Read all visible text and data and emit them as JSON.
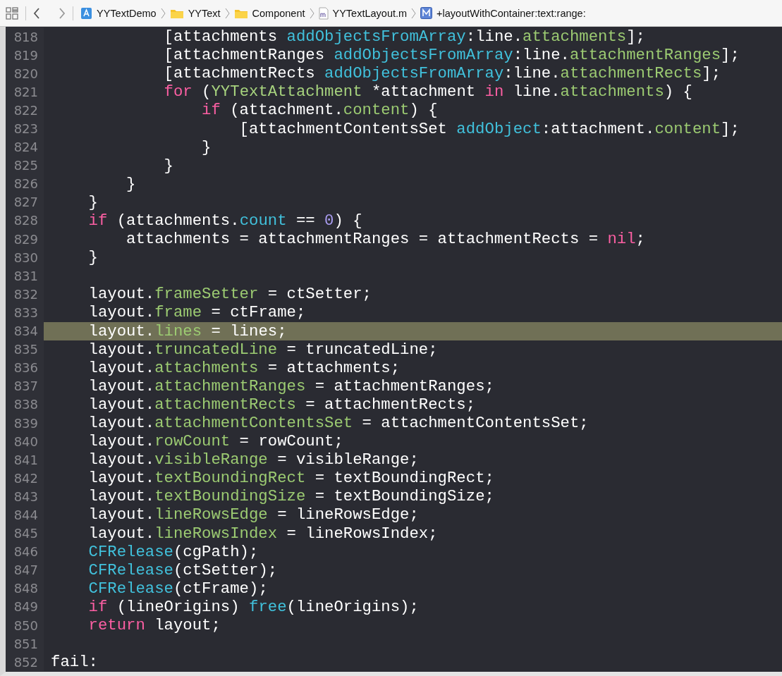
{
  "jump_bar": {
    "crumbs": [
      {
        "kind": "app",
        "label": "YYTextDemo"
      },
      {
        "kind": "folder",
        "label": "YYText"
      },
      {
        "kind": "folder",
        "label": "Component"
      },
      {
        "kind": "file",
        "label": "YYTextLayout.m"
      },
      {
        "kind": "method",
        "label": "+layoutWithContainer:text:range:"
      }
    ]
  },
  "editor": {
    "lines": [
      {
        "number": "818",
        "current": false,
        "tokens": [
          {
            "kind": "plain",
            "text": "            [attachments "
          },
          {
            "kind": "call",
            "text": "addObjectsFromArray"
          },
          {
            "kind": "plain",
            "text": ":line."
          },
          {
            "kind": "prop",
            "text": "attachments"
          },
          {
            "kind": "plain",
            "text": "];"
          }
        ]
      },
      {
        "number": "819",
        "current": false,
        "tokens": [
          {
            "kind": "plain",
            "text": "            [attachmentRanges "
          },
          {
            "kind": "call",
            "text": "addObjectsFromArray"
          },
          {
            "kind": "plain",
            "text": ":line."
          },
          {
            "kind": "prop",
            "text": "attachmentRanges"
          },
          {
            "kind": "plain",
            "text": "];"
          }
        ]
      },
      {
        "number": "820",
        "current": false,
        "tokens": [
          {
            "kind": "plain",
            "text": "            [attachmentRects "
          },
          {
            "kind": "call",
            "text": "addObjectsFromArray"
          },
          {
            "kind": "plain",
            "text": ":line."
          },
          {
            "kind": "prop",
            "text": "attachmentRects"
          },
          {
            "kind": "plain",
            "text": "];"
          }
        ]
      },
      {
        "number": "821",
        "current": false,
        "tokens": [
          {
            "kind": "keyword",
            "text": "            for"
          },
          {
            "kind": "plain",
            "text": " ("
          },
          {
            "kind": "type",
            "text": "YYTextAttachment"
          },
          {
            "kind": "plain",
            "text": " *attachment "
          },
          {
            "kind": "keyword",
            "text": "in"
          },
          {
            "kind": "plain",
            "text": " line."
          },
          {
            "kind": "prop",
            "text": "attachments"
          },
          {
            "kind": "plain",
            "text": ") {"
          }
        ]
      },
      {
        "number": "822",
        "current": false,
        "tokens": [
          {
            "kind": "keyword",
            "text": "                if"
          },
          {
            "kind": "plain",
            "text": " (attachment."
          },
          {
            "kind": "prop",
            "text": "content"
          },
          {
            "kind": "plain",
            "text": ") {"
          }
        ]
      },
      {
        "number": "823",
        "current": false,
        "tokens": [
          {
            "kind": "plain",
            "text": "                    [attachmentContentsSet "
          },
          {
            "kind": "call",
            "text": "addObject"
          },
          {
            "kind": "plain",
            "text": ":attachment."
          },
          {
            "kind": "prop",
            "text": "content"
          },
          {
            "kind": "plain",
            "text": "];"
          }
        ]
      },
      {
        "number": "824",
        "current": false,
        "tokens": [
          {
            "kind": "plain",
            "text": "                }"
          }
        ]
      },
      {
        "number": "825",
        "current": false,
        "tokens": [
          {
            "kind": "plain",
            "text": "            }"
          }
        ]
      },
      {
        "number": "826",
        "current": false,
        "tokens": [
          {
            "kind": "plain",
            "text": "        }"
          }
        ]
      },
      {
        "number": "827",
        "current": false,
        "tokens": [
          {
            "kind": "plain",
            "text": "    }"
          }
        ]
      },
      {
        "number": "828",
        "current": false,
        "tokens": [
          {
            "kind": "keyword",
            "text": "    if"
          },
          {
            "kind": "plain",
            "text": " (attachments."
          },
          {
            "kind": "call",
            "text": "count"
          },
          {
            "kind": "plain",
            "text": " == "
          },
          {
            "kind": "number",
            "text": "0"
          },
          {
            "kind": "plain",
            "text": ") {"
          }
        ]
      },
      {
        "number": "829",
        "current": false,
        "tokens": [
          {
            "kind": "plain",
            "text": "        attachments = attachmentRanges = attachmentRects = "
          },
          {
            "kind": "keyword",
            "text": "nil"
          },
          {
            "kind": "plain",
            "text": ";"
          }
        ]
      },
      {
        "number": "830",
        "current": false,
        "tokens": [
          {
            "kind": "plain",
            "text": "    }"
          }
        ]
      },
      {
        "number": "831",
        "current": false
      },
      {
        "number": "832",
        "current": false,
        "tokens": [
          {
            "kind": "plain",
            "text": "    layout."
          },
          {
            "kind": "prop",
            "text": "frameSetter"
          },
          {
            "kind": "plain",
            "text": " = ctSetter;"
          }
        ]
      },
      {
        "number": "833",
        "current": false,
        "tokens": [
          {
            "kind": "plain",
            "text": "    layout."
          },
          {
            "kind": "prop",
            "text": "frame"
          },
          {
            "kind": "plain",
            "text": " = ctFrame;"
          }
        ]
      },
      {
        "number": "834",
        "current": true,
        "tokens": [
          {
            "kind": "plain",
            "text": "    layout."
          },
          {
            "kind": "prop",
            "text": "lines"
          },
          {
            "kind": "plain",
            "text": " = lines;"
          }
        ]
      },
      {
        "number": "835",
        "current": false,
        "tokens": [
          {
            "kind": "plain",
            "text": "    layout."
          },
          {
            "kind": "prop",
            "text": "truncatedLine"
          },
          {
            "kind": "plain",
            "text": " = truncatedLine;"
          }
        ]
      },
      {
        "number": "836",
        "current": false,
        "tokens": [
          {
            "kind": "plain",
            "text": "    layout."
          },
          {
            "kind": "prop",
            "text": "attachments"
          },
          {
            "kind": "plain",
            "text": " = attachments;"
          }
        ]
      },
      {
        "number": "837",
        "current": false,
        "tokens": [
          {
            "kind": "plain",
            "text": "    layout."
          },
          {
            "kind": "prop",
            "text": "attachmentRanges"
          },
          {
            "kind": "plain",
            "text": " = attachmentRanges;"
          }
        ]
      },
      {
        "number": "838",
        "current": false,
        "tokens": [
          {
            "kind": "plain",
            "text": "    layout."
          },
          {
            "kind": "prop",
            "text": "attachmentRects"
          },
          {
            "kind": "plain",
            "text": " = attachmentRects;"
          }
        ]
      },
      {
        "number": "839",
        "current": false,
        "tokens": [
          {
            "kind": "plain",
            "text": "    layout."
          },
          {
            "kind": "prop",
            "text": "attachmentContentsSet"
          },
          {
            "kind": "plain",
            "text": " = attachmentContentsSet;"
          }
        ]
      },
      {
        "number": "840",
        "current": false,
        "tokens": [
          {
            "kind": "plain",
            "text": "    layout."
          },
          {
            "kind": "prop",
            "text": "rowCount"
          },
          {
            "kind": "plain",
            "text": " = rowCount;"
          }
        ]
      },
      {
        "number": "841",
        "current": false,
        "tokens": [
          {
            "kind": "plain",
            "text": "    layout."
          },
          {
            "kind": "prop",
            "text": "visibleRange"
          },
          {
            "kind": "plain",
            "text": " = visibleRange;"
          }
        ]
      },
      {
        "number": "842",
        "current": false,
        "tokens": [
          {
            "kind": "plain",
            "text": "    layout."
          },
          {
            "kind": "prop",
            "text": "textBoundingRect"
          },
          {
            "kind": "plain",
            "text": " = textBoundingRect;"
          }
        ]
      },
      {
        "number": "843",
        "current": false,
        "tokens": [
          {
            "kind": "plain",
            "text": "    layout."
          },
          {
            "kind": "prop",
            "text": "textBoundingSize"
          },
          {
            "kind": "plain",
            "text": " = textBoundingSize;"
          }
        ]
      },
      {
        "number": "844",
        "current": false,
        "tokens": [
          {
            "kind": "plain",
            "text": "    layout."
          },
          {
            "kind": "prop",
            "text": "lineRowsEdge"
          },
          {
            "kind": "plain",
            "text": " = lineRowsEdge;"
          }
        ]
      },
      {
        "number": "845",
        "current": false,
        "tokens": [
          {
            "kind": "plain",
            "text": "    layout."
          },
          {
            "kind": "prop",
            "text": "lineRowsIndex"
          },
          {
            "kind": "plain",
            "text": " = lineRowsIndex;"
          }
        ]
      },
      {
        "number": "846",
        "current": false,
        "tokens": [
          {
            "kind": "call",
            "text": "    CFRelease"
          },
          {
            "kind": "plain",
            "text": "(cgPath);"
          }
        ]
      },
      {
        "number": "847",
        "current": false,
        "tokens": [
          {
            "kind": "call",
            "text": "    CFRelease"
          },
          {
            "kind": "plain",
            "text": "(ctSetter);"
          }
        ]
      },
      {
        "number": "848",
        "current": false,
        "tokens": [
          {
            "kind": "call",
            "text": "    CFRelease"
          },
          {
            "kind": "plain",
            "text": "(ctFrame);"
          }
        ]
      },
      {
        "number": "849",
        "current": false,
        "tokens": [
          {
            "kind": "keyword",
            "text": "    if"
          },
          {
            "kind": "plain",
            "text": " (lineOrigins) "
          },
          {
            "kind": "call",
            "text": "free"
          },
          {
            "kind": "plain",
            "text": "(lineOrigins);"
          }
        ]
      },
      {
        "number": "850",
        "current": false,
        "tokens": [
          {
            "kind": "keyword",
            "text": "    return"
          },
          {
            "kind": "plain",
            "text": " layout;"
          }
        ]
      },
      {
        "number": "851",
        "current": false
      },
      {
        "number": "852",
        "current": false,
        "tokens": [
          {
            "kind": "plain",
            "text": "fail:"
          }
        ]
      }
    ]
  }
}
